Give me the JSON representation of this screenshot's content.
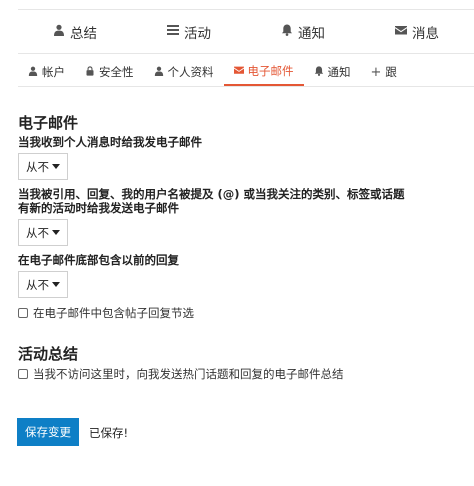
{
  "main_tabs": [
    {
      "label": "总结",
      "icon": "user-icon"
    },
    {
      "label": "活动",
      "icon": "list-icon"
    },
    {
      "label": "通知",
      "icon": "bell-icon"
    },
    {
      "label": "消息",
      "icon": "envelope-icon"
    }
  ],
  "sub_tabs": [
    {
      "label": "帐户",
      "icon": "user-icon",
      "active": false
    },
    {
      "label": "安全性",
      "icon": "lock-icon",
      "active": false
    },
    {
      "label": "个人资料",
      "icon": "user-icon",
      "active": false
    },
    {
      "label": "电子邮件",
      "icon": "envelope-icon",
      "active": true
    },
    {
      "label": "通知",
      "icon": "bell-icon",
      "active": false
    },
    {
      "label": "跟",
      "icon": "plus-icon",
      "active": false
    }
  ],
  "email_section": {
    "title": "电子邮件",
    "pm_label": "当我收到个人消息时给我发电子邮件",
    "pm_value": "从不",
    "quote_label_line1": "当我被引用、回复、我的用户名被提及 (@) 或当我关注的类别、标签或话题",
    "quote_label_line2": "有新的活动时给我发送电子邮件",
    "quote_value": "从不",
    "previous_label": "在电子邮件底部包含以前的回复",
    "previous_value": "从不",
    "include_context_label": "在电子邮件中包含帖子回复节选"
  },
  "digest_section": {
    "title": "活动总结",
    "digest_label": "当我不访问这里时，向我发送热门话题和回复的电子邮件总结"
  },
  "footer": {
    "save_label": "保存变更",
    "saved_text": "已保存!"
  },
  "colors": {
    "accent": "#e45735",
    "primary_button": "#0e7fc6"
  }
}
